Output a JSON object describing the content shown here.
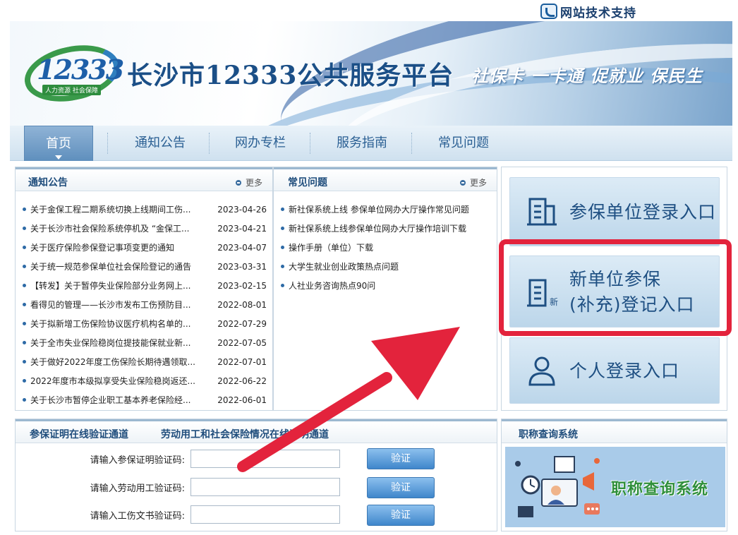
{
  "topbar": {
    "support_label": "网站技术支持"
  },
  "banner": {
    "logo_number": "12333",
    "logo_subtitle": "人力资源 社会保障",
    "site_title": "长沙市12333公共服务平台",
    "slogan": "社保卡 一卡通 促就业 保民生"
  },
  "nav": {
    "items": [
      {
        "label": "首页",
        "active": true
      },
      {
        "label": "通知公告"
      },
      {
        "label": "网办专栏"
      },
      {
        "label": "服务指南"
      },
      {
        "label": "常见问题"
      }
    ]
  },
  "notices": {
    "title": "通知公告",
    "more_label": "更多",
    "items": [
      {
        "title": "关于金保工程二期系统切换上线期间工伤...",
        "date": "2023-04-26"
      },
      {
        "title": "关于长沙市社会保险系统停机及 “金保工...",
        "date": "2023-04-21"
      },
      {
        "title": "关于医疗保险参保登记事项变更的通知",
        "date": "2023-04-07"
      },
      {
        "title": "关于统一规范参保单位社会保险登记的通告",
        "date": "2023-03-31"
      },
      {
        "title": "【转发】关于暂停失业保险部分业务网上...",
        "date": "2023-02-15"
      },
      {
        "title": "看得见的管理——长沙市发布工伤预防目...",
        "date": "2022-08-01"
      },
      {
        "title": "关于拟新增工伤保险协议医疗机构名单的...",
        "date": "2022-07-29"
      },
      {
        "title": "关于全市失业保险稳岗位提技能保就业新...",
        "date": "2022-07-05"
      },
      {
        "title": "关于做好2022年度工伤保险长期待遇领取...",
        "date": "2022-07-01"
      },
      {
        "title": "2022年度市本级拟享受失业保险稳岗返还...",
        "date": "2022-06-22"
      },
      {
        "title": "关于长沙市暂停企业职工基本养老保险经...",
        "date": "2022-06-01"
      }
    ]
  },
  "faq": {
    "title": "常见问题",
    "more_label": "更多",
    "items": [
      "新社保系统上线 参保单位网办大厅操作常见问题",
      "新社保系统上线参保单位网办大厅操作培训下载",
      "操作手册（单位）下载",
      "大学生就业创业政策热点问题",
      "人社业务咨询热点90问"
    ]
  },
  "entries": {
    "unit_login": "参保单位登录入口",
    "new_unit_line1": "新单位参保",
    "new_unit_line2": "(补充)登记入口",
    "new_badge": "新",
    "personal_login": "个人登录入口"
  },
  "verify": {
    "tab1": "参保证明在线验证通道",
    "tab2": "劳动用工和社会保险情况在线证明通道",
    "rows": [
      {
        "label": "请输入参保证明验证码:",
        "button": "验证"
      },
      {
        "label": "请输入劳动用工验证码:",
        "button": "验证"
      },
      {
        "label": "请输入工伤文书验证码:",
        "button": "验证"
      }
    ]
  },
  "title_query": {
    "title": "职称查询系统",
    "banner_text": "职称查询系统"
  },
  "colors": {
    "primary": "#1f4d7c",
    "highlight": "#e3233c",
    "arrow": "#e3233c",
    "nav_active": "#6f9cc8"
  }
}
